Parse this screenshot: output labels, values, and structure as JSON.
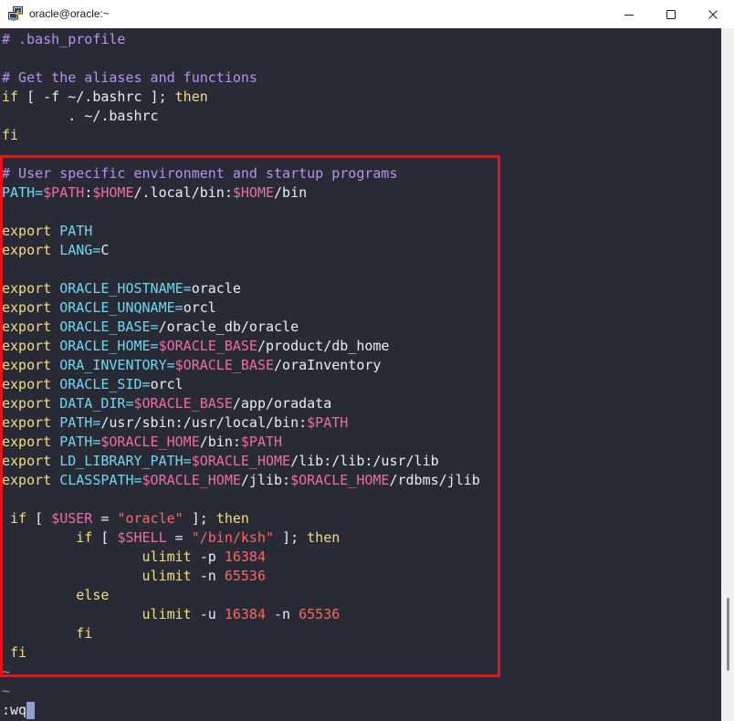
{
  "window": {
    "title": "oracle@oracle:~",
    "icons": {
      "app": "putty-icon",
      "minimize": "minimize-icon",
      "maximize": "maximize-icon",
      "close": "close-icon"
    }
  },
  "colors": {
    "title_bar": "#ffffff",
    "terminal_background": "#282b36",
    "highlight_box": "#e3141c",
    "cursor": "#8e9ed6",
    "tilde": "#8a99cc",
    "command_text": "#ececec",
    "scrollbar_track": "#f0f0f0"
  },
  "editor": {
    "file_lines": [
      [
        [
          "# .bash_profile",
          "#b592ee"
        ]
      ],
      [],
      [
        [
          "# Get the aliases and functions",
          "#b592ee"
        ]
      ],
      [
        [
          "if",
          "#f2dd7e"
        ],
        [
          " [ -f ~/.bashrc ]; ",
          "#ececec"
        ],
        [
          "then",
          "#f2dd7e"
        ]
      ],
      [
        [
          "        . ~/.bashrc",
          "#ececec"
        ]
      ],
      [
        [
          "fi",
          "#f2dd7e"
        ]
      ],
      [],
      [
        [
          "# User specific environment and startup programs",
          "#b592ee"
        ]
      ],
      [
        [
          "PATH=",
          "#6ed7ef"
        ],
        [
          "$PATH",
          "#f06aa8"
        ],
        [
          ":",
          "#ececec"
        ],
        [
          "$HOME",
          "#f06aa8"
        ],
        [
          "/.local/bin:",
          "#ececec"
        ],
        [
          "$HOME",
          "#f06aa8"
        ],
        [
          "/bin",
          "#ececec"
        ]
      ],
      [],
      [
        [
          "export",
          "#f2dd7e"
        ],
        [
          " PATH",
          "#6ed7ef"
        ]
      ],
      [
        [
          "export",
          "#f2dd7e"
        ],
        [
          " LANG=",
          "#6ed7ef"
        ],
        [
          "C",
          "#ececec"
        ]
      ],
      [],
      [
        [
          "export",
          "#f2dd7e"
        ],
        [
          " ORACLE_HOSTNAME=",
          "#6ed7ef"
        ],
        [
          "oracle",
          "#ececec"
        ]
      ],
      [
        [
          "export",
          "#f2dd7e"
        ],
        [
          " ORACLE_UNQNAME=",
          "#6ed7ef"
        ],
        [
          "orcl",
          "#ececec"
        ]
      ],
      [
        [
          "export",
          "#f2dd7e"
        ],
        [
          " ORACLE_BASE=",
          "#6ed7ef"
        ],
        [
          "/oracle_db/oracle",
          "#ececec"
        ]
      ],
      [
        [
          "export",
          "#f2dd7e"
        ],
        [
          " ORACLE_HOME=",
          "#6ed7ef"
        ],
        [
          "$ORACLE_BASE",
          "#f06aa8"
        ],
        [
          "/product/db_home",
          "#ececec"
        ]
      ],
      [
        [
          "export",
          "#f2dd7e"
        ],
        [
          " ORA_INVENTORY=",
          "#6ed7ef"
        ],
        [
          "$ORACLE_BASE",
          "#f06aa8"
        ],
        [
          "/oraInventory",
          "#ececec"
        ]
      ],
      [
        [
          "export",
          "#f2dd7e"
        ],
        [
          " ORACLE_SID=",
          "#6ed7ef"
        ],
        [
          "orcl",
          "#ececec"
        ]
      ],
      [
        [
          "export",
          "#f2dd7e"
        ],
        [
          " DATA_DIR=",
          "#6ed7ef"
        ],
        [
          "$ORACLE_BASE",
          "#f06aa8"
        ],
        [
          "/app/oradata",
          "#ececec"
        ]
      ],
      [
        [
          "export",
          "#f2dd7e"
        ],
        [
          " PATH=",
          "#6ed7ef"
        ],
        [
          "/usr/sbin:/usr/local/bin:",
          "#ececec"
        ],
        [
          "$PATH",
          "#f06aa8"
        ]
      ],
      [
        [
          "export",
          "#f2dd7e"
        ],
        [
          " PATH=",
          "#6ed7ef"
        ],
        [
          "$ORACLE_HOME",
          "#f06aa8"
        ],
        [
          "/bin:",
          "#ececec"
        ],
        [
          "$PATH",
          "#f06aa8"
        ]
      ],
      [
        [
          "export",
          "#f2dd7e"
        ],
        [
          " LD_LIBRARY_PATH=",
          "#6ed7ef"
        ],
        [
          "$ORACLE_HOME",
          "#f06aa8"
        ],
        [
          "/lib:/lib:/usr/lib",
          "#ececec"
        ]
      ],
      [
        [
          "export",
          "#f2dd7e"
        ],
        [
          " CLASSPATH=",
          "#6ed7ef"
        ],
        [
          "$ORACLE_HOME",
          "#f06aa8"
        ],
        [
          "/jlib:",
          "#ececec"
        ],
        [
          "$ORACLE_HOME",
          "#f06aa8"
        ],
        [
          "/rdbms/jlib",
          "#ececec"
        ]
      ],
      [],
      [
        [
          " if",
          "#f2dd7e"
        ],
        [
          " [ ",
          "#ececec"
        ],
        [
          "$USER",
          "#f06aa8"
        ],
        [
          " = ",
          "#ececec"
        ],
        [
          "\"oracle\"",
          "#ff6464"
        ],
        [
          " ]; ",
          "#ececec"
        ],
        [
          "then",
          "#f2dd7e"
        ]
      ],
      [
        [
          "         if",
          "#f2dd7e"
        ],
        [
          " [ ",
          "#ececec"
        ],
        [
          "$SHELL",
          "#f06aa8"
        ],
        [
          " = ",
          "#ececec"
        ],
        [
          "\"/bin/ksh\"",
          "#ff6464"
        ],
        [
          " ]; ",
          "#ececec"
        ],
        [
          "then",
          "#f2dd7e"
        ]
      ],
      [
        [
          "                 ulimit",
          "#f2dd7e"
        ],
        [
          " -p ",
          "#ececec"
        ],
        [
          "16384",
          "#ff6464"
        ]
      ],
      [
        [
          "                 ulimit",
          "#f2dd7e"
        ],
        [
          " -n ",
          "#ececec"
        ],
        [
          "65536",
          "#ff6464"
        ]
      ],
      [
        [
          "         else",
          "#f2dd7e"
        ]
      ],
      [
        [
          "                 ulimit",
          "#f2dd7e"
        ],
        [
          " -u ",
          "#ececec"
        ],
        [
          "16384",
          "#ff6464"
        ],
        [
          " -n ",
          "#ececec"
        ],
        [
          "65536",
          "#ff6464"
        ]
      ],
      [
        [
          "         fi",
          "#f2dd7e"
        ]
      ],
      [
        [
          " fi",
          "#f2dd7e"
        ]
      ]
    ],
    "tilde_lines": [
      "~",
      "~"
    ],
    "command_line": ":wq"
  }
}
